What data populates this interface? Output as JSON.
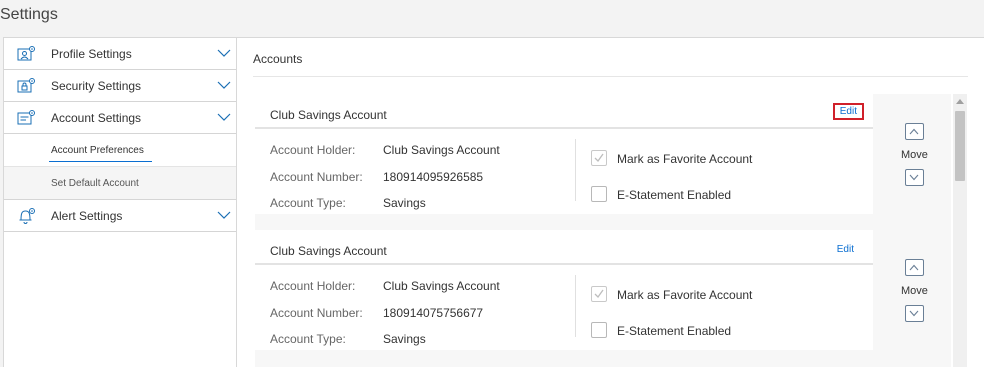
{
  "page": {
    "title": "Settings"
  },
  "sidebar": {
    "items": [
      {
        "label": "Profile Settings",
        "icon": "profile-settings-icon"
      },
      {
        "label": "Security Settings",
        "icon": "security-settings-icon"
      },
      {
        "label": "Account Settings",
        "icon": "account-settings-icon"
      }
    ],
    "sub_items": [
      {
        "label": "Account Preferences"
      },
      {
        "label": "Set Default Account"
      }
    ],
    "alert": {
      "label": "Alert Settings",
      "icon": "bell-settings-icon"
    }
  },
  "content": {
    "heading": "Accounts",
    "cards": [
      {
        "title": "Club Savings Account",
        "edit_label": "Edit",
        "holder_label": "Account Holder:",
        "holder_value": "Club Savings Account",
        "number_label": "Account Number:",
        "number_value": "180914095926585",
        "type_label": "Account Type:",
        "type_value": "Savings",
        "favorite_label": "Mark as Favorite Account",
        "favorite_checked": true,
        "estatement_label": "E-Statement Enabled",
        "estatement_checked": false,
        "move_label": "Move"
      },
      {
        "title": "Club Savings Account",
        "edit_label": "Edit",
        "holder_label": "Account Holder:",
        "holder_value": "Club Savings Account",
        "number_label": "Account Number:",
        "number_value": "180914075756677",
        "type_label": "Account Type:",
        "type_value": "Savings",
        "favorite_label": "Mark as Favorite Account",
        "favorite_checked": true,
        "estatement_label": "E-Statement Enabled",
        "estatement_checked": false,
        "move_label": "Move"
      }
    ]
  },
  "colors": {
    "accent": "#0a6ed1",
    "highlight": "#d0202a",
    "icon": "#1a6fb5"
  }
}
